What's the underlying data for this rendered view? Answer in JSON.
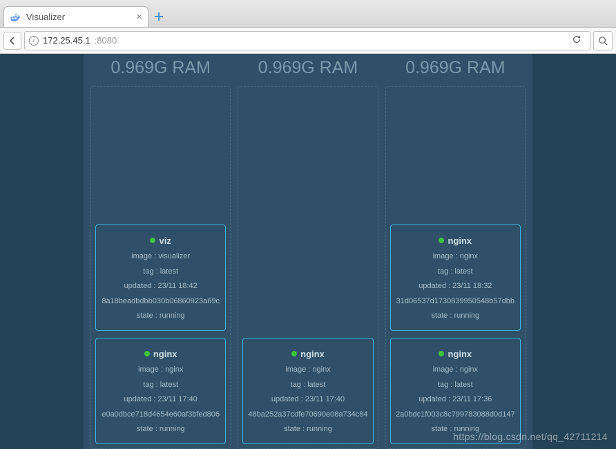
{
  "browser": {
    "tab_title": "Visualizer",
    "url_host": "172.25.45.1",
    "url_port": ":8080"
  },
  "nodes": [
    {
      "ram": "0.969G RAM",
      "containers": [
        {
          "name": "viz",
          "image": "image : visualizer",
          "tag": "tag : latest",
          "updated": "updated : 23/11 18:42",
          "id": "8a18beadbdbb030b06860923a69c",
          "state": "state : running"
        },
        {
          "name": "nginx",
          "image": "image : nginx",
          "tag": "tag : latest",
          "updated": "updated : 23/11 17:40",
          "id": "e0a0dbce718d4654e60af3bfed806",
          "state": "state : running"
        }
      ]
    },
    {
      "ram": "0.969G RAM",
      "containers": [
        {
          "name": "nginx",
          "image": "image : nginx",
          "tag": "tag : latest",
          "updated": "updated : 23/11 17:40",
          "id": "48ba252a37cdfe70690e08a734c84",
          "state": "state : running"
        }
      ]
    },
    {
      "ram": "0.969G RAM",
      "containers": [
        {
          "name": "nginx",
          "image": "image : nginx",
          "tag": "tag : latest",
          "updated": "updated : 23/11 18:32",
          "id": "31d06537d1730839950548b57dbb",
          "state": "state : running"
        },
        {
          "name": "nginx",
          "image": "image : nginx",
          "tag": "tag : latest",
          "updated": "updated : 23/11 17:36",
          "id": "2a0bdc1f003c8c799783088d0d147",
          "state": "state : running"
        }
      ]
    }
  ],
  "watermark": "https://blog.csdn.net/qq_42711214"
}
